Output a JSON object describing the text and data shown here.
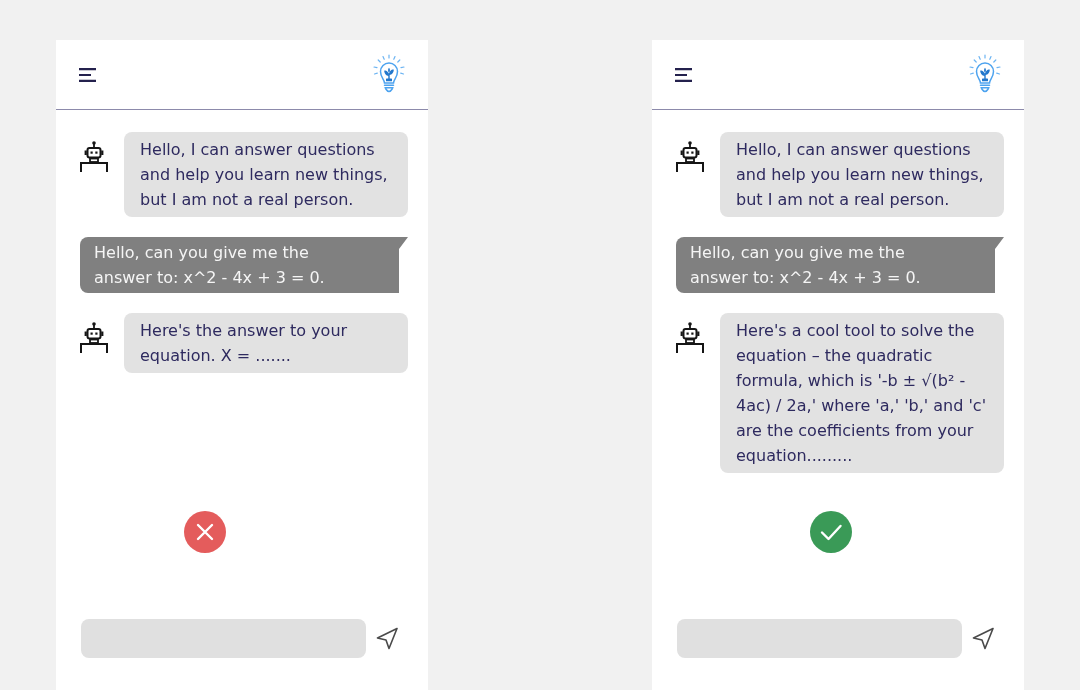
{
  "panels": [
    {
      "messages": [
        {
          "kind": "bot",
          "text": "Hello, I can answer questions and help you learn new things, but I am not a real person."
        },
        {
          "kind": "user",
          "text": "Hello, can you give me the answer to: x^2 - 4x + 3 = 0."
        },
        {
          "kind": "bot",
          "text": "Here's the answer to your equation. X = ......."
        }
      ],
      "verdict": {
        "correct": false
      }
    },
    {
      "messages": [
        {
          "kind": "bot",
          "text": "Hello, I can answer questions and help you learn new things, but I am not a real person."
        },
        {
          "kind": "user",
          "text": "Hello, can you give me the answer to: x^2 - 4x + 3 = 0."
        },
        {
          "kind": "bot",
          "text": "Here's a cool tool to solve the equation – the quadratic formula, which is '-b ± √(b² - 4ac) / 2a,' where 'a,' 'b,' and 'c' are the coefficients from your equation........."
        }
      ],
      "verdict": {
        "correct": true
      }
    }
  ]
}
